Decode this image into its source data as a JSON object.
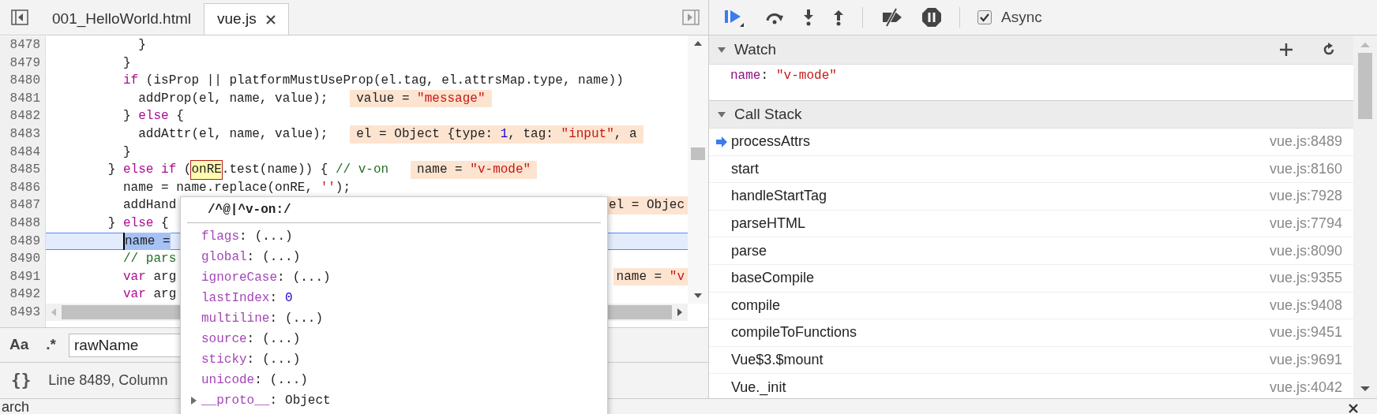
{
  "editor": {
    "tabs": [
      {
        "label": "001_HelloWorld.html",
        "selected": false
      },
      {
        "label": "vue.js",
        "selected": true
      }
    ],
    "lines": [
      {
        "number": "8478",
        "current": false,
        "segments": [
          {
            "text": "            }",
            "kind": "plain"
          }
        ]
      },
      {
        "number": "8479",
        "current": false,
        "segments": [
          {
            "text": "          }",
            "kind": "plain"
          }
        ]
      },
      {
        "number": "8480",
        "current": false,
        "segments": [
          {
            "text": "          if",
            "kind": "keyword"
          },
          {
            "text": " (isProp || platformMustUseProp(el.tag, el.attrsMap.type, name))",
            "kind": "plain"
          }
        ]
      },
      {
        "number": "8481",
        "current": false,
        "segments": [
          {
            "text": "            addProp(el, name, value);",
            "kind": "plain"
          }
        ],
        "hint": [
          {
            "text": "value = ",
            "kind": "plain"
          },
          {
            "text": "\"message\"",
            "kind": "string"
          }
        ]
      },
      {
        "number": "8482",
        "current": false,
        "segments": [
          {
            "text": "          } ",
            "kind": "plain"
          },
          {
            "text": "else",
            "kind": "keyword"
          },
          {
            "text": " {",
            "kind": "plain"
          }
        ]
      },
      {
        "number": "8483",
        "current": false,
        "segments": [
          {
            "text": "            addAttr(el, name, value);",
            "kind": "plain"
          }
        ],
        "hint": [
          {
            "text": "el = Object {type: ",
            "kind": "plain"
          },
          {
            "text": "1",
            "kind": "number"
          },
          {
            "text": ", tag: ",
            "kind": "plain"
          },
          {
            "text": "\"input\"",
            "kind": "string"
          },
          {
            "text": ", a",
            "kind": "plain"
          }
        ]
      },
      {
        "number": "8484",
        "current": false,
        "segments": [
          {
            "text": "          }",
            "kind": "plain"
          }
        ]
      },
      {
        "number": "8485",
        "current": false,
        "segments": [
          {
            "text": "        } ",
            "kind": "plain"
          },
          {
            "text": "else if",
            "kind": "keyword"
          },
          {
            "text": " (",
            "kind": "plain"
          },
          {
            "text": "onRE",
            "kind": "match"
          },
          {
            "text": ".test(name)) { ",
            "kind": "plain"
          },
          {
            "text": "// v-on",
            "kind": "comment"
          }
        ],
        "hint": [
          {
            "text": "name = ",
            "kind": "plain"
          },
          {
            "text": "\"v-mode\"",
            "kind": "string"
          }
        ]
      },
      {
        "number": "8486",
        "current": false,
        "segments": [
          {
            "text": "          name = name.replace(onRE, ",
            "kind": "plain"
          },
          {
            "text": "''",
            "kind": "string"
          },
          {
            "text": ");",
            "kind": "plain"
          }
        ]
      },
      {
        "number": "8487",
        "current": false,
        "segments": [
          {
            "text": "          addHand",
            "kind": "plain"
          }
        ],
        "tail": [
          {
            "text": "el = Objec",
            "kind": "plain"
          }
        ]
      },
      {
        "number": "8488",
        "current": false,
        "segments": [
          {
            "text": "        } ",
            "kind": "plain"
          },
          {
            "text": "else",
            "kind": "keyword"
          },
          {
            "text": " {",
            "kind": "plain"
          }
        ]
      },
      {
        "number": "8489",
        "current": true,
        "segments": [
          {
            "text": "          name =",
            "kind": "selection"
          }
        ]
      },
      {
        "number": "8490",
        "current": false,
        "segments": [
          {
            "text": "          // pars",
            "kind": "comment"
          }
        ]
      },
      {
        "number": "8491",
        "current": false,
        "segments": [
          {
            "text": "          var",
            "kind": "keyword"
          },
          {
            "text": " arg",
            "kind": "plain"
          }
        ],
        "tail": [
          {
            "text": "name = ",
            "kind": "plain"
          },
          {
            "text": "\"v",
            "kind": "string"
          }
        ]
      },
      {
        "number": "8492",
        "current": false,
        "segments": [
          {
            "text": "          var",
            "kind": "keyword"
          },
          {
            "text": " arg",
            "kind": "plain"
          }
        ]
      },
      {
        "number": "8493",
        "current": false
      }
    ],
    "search": {
      "case_toggle": "Aa",
      "regex_toggle": ".*",
      "value": "rawName"
    },
    "status": {
      "format_toggle": "{}",
      "position": "Line 8489, Column"
    },
    "popover": {
      "title": "/^@|^v-on:/",
      "properties": [
        {
          "key": "flags",
          "sep": ":",
          "value": "(...)",
          "kind": "getter"
        },
        {
          "key": "global",
          "sep": ":",
          "value": "(...)",
          "kind": "getter"
        },
        {
          "key": "ignoreCase",
          "sep": ":",
          "value": "(...)",
          "kind": "getter"
        },
        {
          "key": "lastIndex",
          "sep": ":",
          "value": "0",
          "kind": "number"
        },
        {
          "key": "multiline",
          "sep": ":",
          "value": "(...)",
          "kind": "getter"
        },
        {
          "key": "source",
          "sep": ":",
          "value": "(...)",
          "kind": "getter"
        },
        {
          "key": "sticky",
          "sep": ":",
          "value": "(...)",
          "kind": "getter"
        },
        {
          "key": "unicode",
          "sep": ":",
          "value": "(...)",
          "kind": "getter"
        },
        {
          "key": "__proto__",
          "sep": ":",
          "value": "Object",
          "kind": "object"
        }
      ]
    }
  },
  "debugger": {
    "async": {
      "label": "Async",
      "checked": true
    },
    "watch": {
      "title": "Watch",
      "expanded": true,
      "items": [
        {
          "expression": "name",
          "sep": ":",
          "value": "\"v-mode\""
        }
      ]
    },
    "call_stack": {
      "title": "Call Stack",
      "expanded": true,
      "frames": [
        {
          "function": "processAttrs",
          "location": "vue.js:8489",
          "current": true
        },
        {
          "function": "start",
          "location": "vue.js:8160",
          "current": false
        },
        {
          "function": "handleStartTag",
          "location": "vue.js:7928",
          "current": false
        },
        {
          "function": "parseHTML",
          "location": "vue.js:7794",
          "current": false
        },
        {
          "function": "parse",
          "location": "vue.js:8090",
          "current": false
        },
        {
          "function": "baseCompile",
          "location": "vue.js:9355",
          "current": false
        },
        {
          "function": "compile",
          "location": "vue.js:9408",
          "current": false
        },
        {
          "function": "compileToFunctions",
          "location": "vue.js:9451",
          "current": false
        },
        {
          "function": "Vue$3.$mount",
          "location": "vue.js:9691",
          "current": false
        },
        {
          "function": "Vue._init",
          "location": "vue.js:4042",
          "current": false
        }
      ]
    }
  },
  "drawer": {
    "tab": "arch"
  }
}
